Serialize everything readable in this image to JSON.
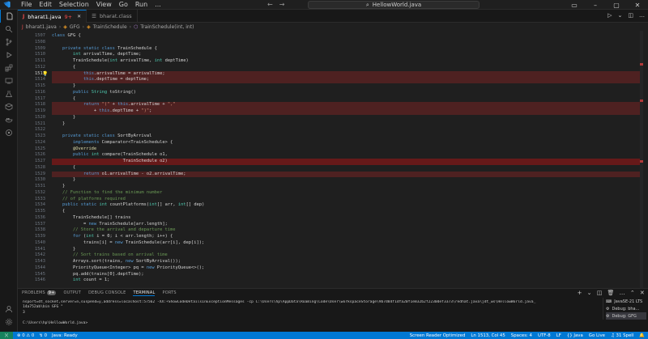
{
  "menu": [
    "File",
    "Edit",
    "Selection",
    "View",
    "Go",
    "Run",
    "..."
  ],
  "search": {
    "text": "HellowWorld.java"
  },
  "tabs": [
    {
      "label": "bharat1.java",
      "badge": "9+",
      "active": true
    },
    {
      "label": "bharat.class",
      "active": false
    }
  ],
  "breadcrumb": [
    "bharat1.java",
    "GFG",
    "TrainSchedule",
    "TrainSchedule(int, int)"
  ],
  "editor": {
    "lines": [
      {
        "n": "1507",
        "text": "class GFG {",
        "hl": ""
      },
      {
        "n": "1508",
        "text": "",
        "hl": ""
      },
      {
        "n": "1509",
        "text": "    private static class TrainSchedule {",
        "hl": ""
      },
      {
        "n": "1510",
        "text": "        int arrivalTime, deptTime;",
        "hl": ""
      },
      {
        "n": "1511",
        "text": "        TrainSchedule(int arrivalTime, int deptTime)",
        "hl": ""
      },
      {
        "n": "1512",
        "text": "        {",
        "hl": ""
      },
      {
        "n": "1513",
        "text": "            this.arrivalTime = arrivalTime;",
        "hl": "err",
        "cur": true
      },
      {
        "n": "1514",
        "text": "            this.deptTime = deptTime;",
        "hl": "err"
      },
      {
        "n": "1515",
        "text": "        }",
        "hl": ""
      },
      {
        "n": "1516",
        "text": "        public String toString()",
        "hl": ""
      },
      {
        "n": "1517",
        "text": "        {",
        "hl": ""
      },
      {
        "n": "1518",
        "text": "            return \"(\" + this.arrivalTime + \",\"",
        "hl": "err"
      },
      {
        "n": "1519",
        "text": "                + this.deptTime + \")\";",
        "hl": "err"
      },
      {
        "n": "1520",
        "text": "        }",
        "hl": ""
      },
      {
        "n": "1521",
        "text": "    }",
        "hl": ""
      },
      {
        "n": "1522",
        "text": "",
        "hl": ""
      },
      {
        "n": "1523",
        "text": "    private static class SortByArrival",
        "hl": ""
      },
      {
        "n": "1524",
        "text": "        implements Comparator<TrainSchedule> {",
        "hl": ""
      },
      {
        "n": "1525",
        "text": "        @Override",
        "hl": ""
      },
      {
        "n": "1526",
        "text": "        public int compare(TrainSchedule o1,",
        "hl": ""
      },
      {
        "n": "1527",
        "text": "                           TrainSchedule o2)",
        "hl": "errbar"
      },
      {
        "n": "1528",
        "text": "        {",
        "hl": ""
      },
      {
        "n": "1529",
        "text": "            return o1.arrivalTime - o2.arrivalTime;",
        "hl": "err"
      },
      {
        "n": "1530",
        "text": "        }",
        "hl": ""
      },
      {
        "n": "1531",
        "text": "    }",
        "hl": ""
      },
      {
        "n": "1532",
        "text": "    // Function to find the minimum number",
        "hl": ""
      },
      {
        "n": "1533",
        "text": "    // of platforms required",
        "hl": ""
      },
      {
        "n": "1534",
        "text": "    public static int countPlatforms(int[] arr, int[] dep)",
        "hl": ""
      },
      {
        "n": "1535",
        "text": "    {",
        "hl": ""
      },
      {
        "n": "1536",
        "text": "        TrainSchedule[] trains",
        "hl": ""
      },
      {
        "n": "1537",
        "text": "            = new TrainSchedule[arr.length];",
        "hl": ""
      },
      {
        "n": "1538",
        "text": "        // Store the arrival and departure time",
        "hl": ""
      },
      {
        "n": "1539",
        "text": "        for (int i = 0; i < arr.length; i++) {",
        "hl": ""
      },
      {
        "n": "1540",
        "text": "            trains[i] = new TrainSchedule(arr[i], dep[i]);",
        "hl": ""
      },
      {
        "n": "1541",
        "text": "        }",
        "hl": ""
      },
      {
        "n": "1542",
        "text": "        // Sort trains based on arrival time",
        "hl": ""
      },
      {
        "n": "1543",
        "text": "        Arrays.sort(trains, new SortByArrival());",
        "hl": ""
      },
      {
        "n": "1544",
        "text": "        PriorityQueue<Integer> pq = new PriorityQueue<>();",
        "hl": ""
      },
      {
        "n": "1545",
        "text": "        pq.add(trains[0].deptTime);",
        "hl": ""
      },
      {
        "n": "1546",
        "text": "        int count = 1;",
        "hl": ""
      }
    ]
  },
  "panel": {
    "tabs": [
      "PROBLEMS",
      "OUTPUT",
      "DEBUG CONSOLE",
      "TERMINAL",
      "PORTS"
    ],
    "problems_badge": "9+",
    "active_tab": "TERMINAL",
    "terminal_lines": [
      "nsport=dt_socket,server=n,suspend=y,address=localhost:57562 -XX:+ShowCodeDetailsInExceptionMessages -cp C:\\Users\\hp\\AppData\\Roaming\\Code\\User\\workspaceStorage\\9b7d84f1dfa20f1e832b2f2230def3373\\redhat.java\\jdt_ws\\HellowWorld.java_",
      "14a752ab\\bin GFG \"",
      "3",
      "",
      "C:\\Users\\hp\\HellowWorld.java>"
    ],
    "terminals": [
      {
        "label": "JavaSE-21 LTS",
        "active": false
      },
      {
        "label": "Debug: bha...",
        "active": false
      },
      {
        "label": "Debug: GFG",
        "active": true
      }
    ]
  },
  "statusbar": {
    "left": [
      "⊗ 0  ⚠ 0",
      "↯ 0",
      "Java: Ready"
    ],
    "right": [
      "Screen Reader Optimized",
      "Ln 1513, Col 45",
      "Spaces: 4",
      "UTF-8",
      "LF",
      "{} Java",
      "Go Live",
      "♫ 31 Spell"
    ]
  }
}
